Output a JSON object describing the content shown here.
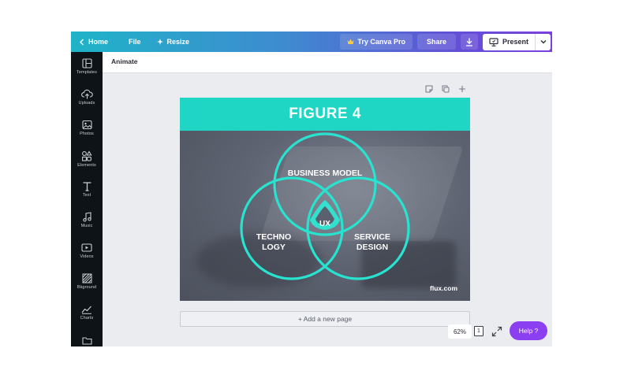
{
  "topbar": {
    "home_label": "Home",
    "file_label": "File",
    "resize_label": "Resize",
    "try_pro_label": "Try Canva Pro",
    "share_label": "Share",
    "present_label": "Present"
  },
  "sidebar": {
    "items": [
      {
        "label": "Templates",
        "icon": "templates-icon"
      },
      {
        "label": "Uploads",
        "icon": "upload-icon"
      },
      {
        "label": "Photos",
        "icon": "photos-icon"
      },
      {
        "label": "Elements",
        "icon": "elements-icon"
      },
      {
        "label": "Text",
        "icon": "text-icon"
      },
      {
        "label": "Music",
        "icon": "music-icon"
      },
      {
        "label": "Videos",
        "icon": "videos-icon"
      },
      {
        "label": "Bkground",
        "icon": "background-icon"
      },
      {
        "label": "Charts",
        "icon": "charts-icon"
      }
    ]
  },
  "toolbar": {
    "animate_label": "Animate"
  },
  "design": {
    "title": "FIGURE 4",
    "venn": {
      "top_label": "BUSINESS MODEL",
      "left_label_line1": "TECHNO",
      "left_label_line2": "LOGY",
      "right_label_line1": "SERVICE",
      "right_label_line2": "DESIGN",
      "center_label": "UX"
    },
    "credit": "flux.com",
    "colors": {
      "accent": "#1fd6c4",
      "circle_stroke": "#27e3d0"
    }
  },
  "canvas": {
    "add_page_label": "+ Add a new page"
  },
  "footer": {
    "zoom": "62%",
    "page_count": "1",
    "help_label": "Help ?"
  }
}
